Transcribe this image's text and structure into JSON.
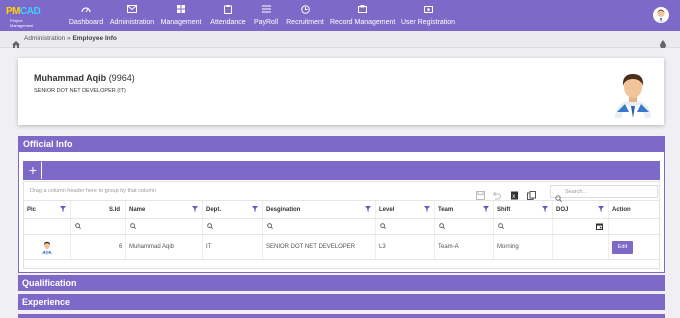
{
  "brand": {
    "logo_text_main": "PM",
    "logo_text_accent": "CAD",
    "logo_sub": "Project Management"
  },
  "nav": {
    "items": [
      {
        "label": "Dashboard",
        "icon": "dashboard-icon"
      },
      {
        "label": "Administration",
        "icon": "envelope-icon"
      },
      {
        "label": "Management",
        "icon": "grid-icon"
      },
      {
        "label": "Attendance",
        "icon": "clipboard-icon"
      },
      {
        "label": "PayRoll",
        "icon": "list-icon"
      },
      {
        "label": "Recruitment",
        "icon": "clock-icon"
      },
      {
        "label": "Record Management",
        "icon": "folder-icon"
      },
      {
        "label": "User Registration",
        "icon": "user-add-icon"
      }
    ]
  },
  "breadcrumb": {
    "section": "Administration",
    "separator": "»",
    "page": "Employee Info"
  },
  "profile": {
    "name": "Muhammad Aqib",
    "emp_id": "(9964)",
    "role": "SENIOR DOT NET DEVELOPER (IT)"
  },
  "sections": {
    "official": "Official Info",
    "qualification": "Qualification",
    "experience": "Experience"
  },
  "grid": {
    "add_label": "+",
    "group_hint": "Drag a column header here to group by that column",
    "search_placeholder": "Search...",
    "columns": [
      "Pic",
      "S.Id",
      "Name",
      "Dept.",
      "Desgination",
      "Level",
      "Team",
      "Shift",
      "DOJ",
      "Action"
    ],
    "rows": [
      {
        "sid": "6",
        "name": "Muhammad Aqib",
        "dept": "IT",
        "designation": "SENIOR DOT NET DEVELOPER",
        "level": "L3",
        "team": "Team-A",
        "shift": "Morning",
        "doj": "",
        "action": "Edit"
      }
    ]
  },
  "colors": {
    "accent": "#7d6ac8"
  }
}
